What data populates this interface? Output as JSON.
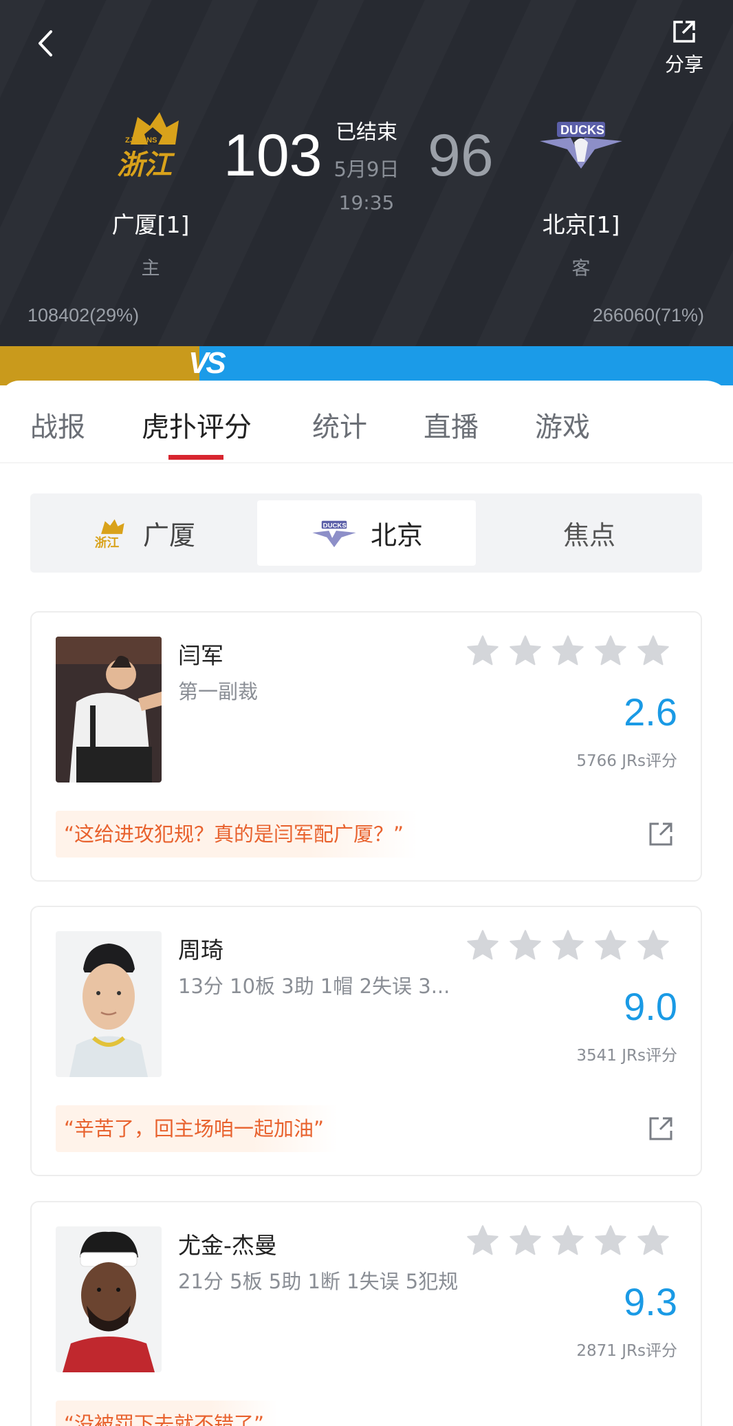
{
  "header": {
    "share_label": "分享",
    "status": "已结束",
    "date": "5月9日",
    "time": "19:35",
    "home": {
      "score": "103",
      "name": "广厦[1]",
      "role": "主",
      "support": "108402(29%)",
      "logo_text": "浙江",
      "logo_subtext": "ZJLIONS"
    },
    "away": {
      "score": "96",
      "name": "北京[1]",
      "role": "客",
      "support": "266060(71%)",
      "logo_text": "DUCKS"
    },
    "vs_text": "VS",
    "colors": {
      "home": "#c99a1c",
      "away": "#1b9be8"
    }
  },
  "tabs": [
    {
      "label": "战报"
    },
    {
      "label": "虎扑评分",
      "active": true
    },
    {
      "label": "统计"
    },
    {
      "label": "直播"
    },
    {
      "label": "游戏"
    }
  ],
  "segment": {
    "items": [
      {
        "label": "广厦"
      },
      {
        "label": "北京",
        "active": true
      },
      {
        "label": "焦点"
      }
    ]
  },
  "cards": [
    {
      "name": "闫军",
      "sub": "第一副裁",
      "rating": "2.6",
      "count": "5766 JRs评分",
      "quote": "“这给进攻犯规？真的是闫军配广厦？”"
    },
    {
      "name": "周琦",
      "sub": "13分 10板 3助 1帽 2失误 3...",
      "rating": "9.0",
      "count": "3541 JRs评分",
      "quote": "“辛苦了，回主场咱一起加油”"
    },
    {
      "name": "尤金-杰曼",
      "sub": "21分 5板 5助 1断 1失误 5犯规",
      "rating": "9.3",
      "count": "2871 JRs评分",
      "quote": "“没被罚下去就不错了”"
    }
  ],
  "icons": {
    "back": "back-arrow-icon",
    "share": "share-icon",
    "star": "star-icon",
    "external": "external-link-icon"
  }
}
